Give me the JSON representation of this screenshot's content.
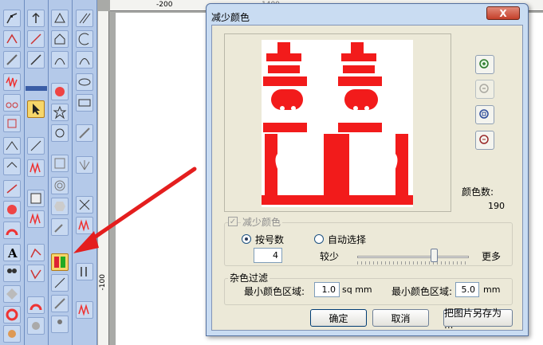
{
  "ruler": {
    "top_label": "-200",
    "top_partial": "1400",
    "left_label": "-100"
  },
  "dialog": {
    "title": "减少颜色",
    "close_label": "X",
    "color_count_label": "颜色数:",
    "color_count_value": "190",
    "reduce_checkbox_label": "减少颜色",
    "radio_by_number_label": "按号数",
    "radio_auto_label": "自动选择",
    "number_value": "4",
    "slider_left_label": "较少",
    "slider_right_label": "更多",
    "slider_level": 0.8,
    "noise_group_label": "杂色过滤",
    "min_color_area_label_1": "最小颜色区域:",
    "min_area_value_1": "1.0",
    "unit_1": "sq mm",
    "min_color_area_label_2": "最小颜色区域:",
    "min_area_value_2": "5.0",
    "unit_2": "mm",
    "ok_label": "确定",
    "cancel_label": "取消",
    "save_image_label": "把图片另存为 ..."
  },
  "colors": {
    "motif_red": "#f21b1b",
    "title_blue": "#2f5aa6",
    "close_red": "#c4402a"
  }
}
